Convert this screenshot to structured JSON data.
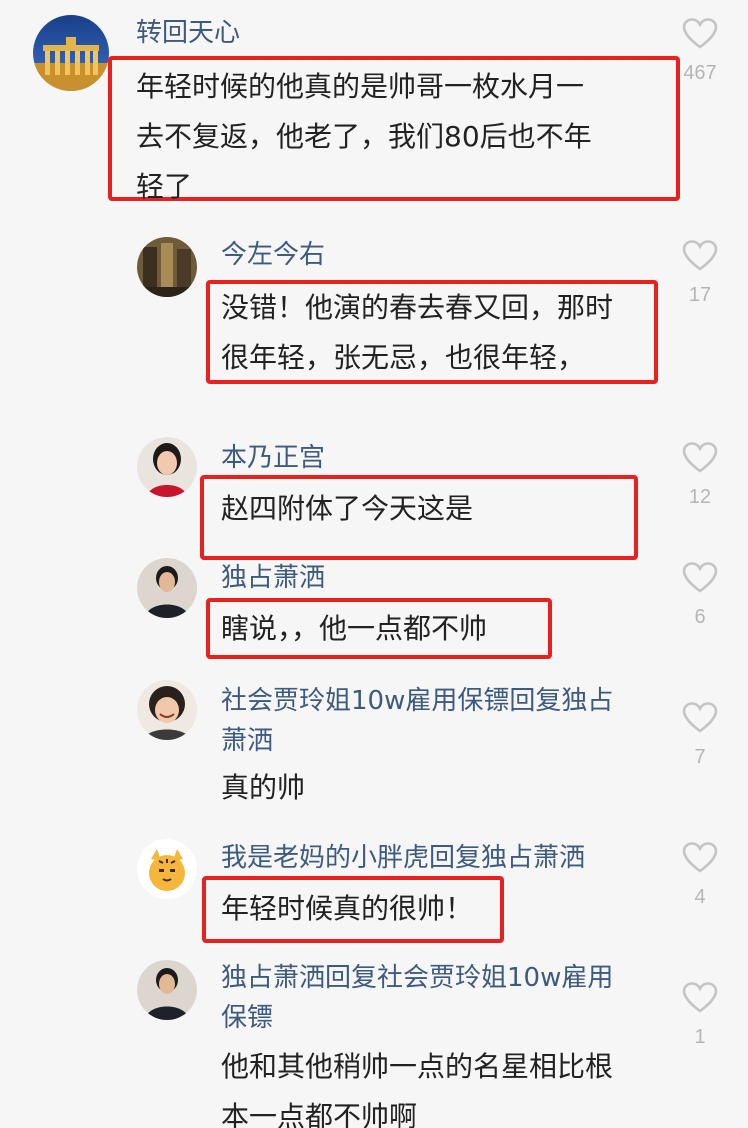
{
  "comments": [
    {
      "user": "转回天心",
      "text_lines": [
        "年轻时候的他真的是帅哥一枚水月一",
        "去不复返，他老了，我们80后也不年",
        "轻了"
      ],
      "likes": "467"
    },
    {
      "user": "今左今右",
      "text_lines": [
        "没错！他演的春去春又回，那时",
        "很年轻，张无忌，也很年轻，"
      ],
      "likes": "17"
    },
    {
      "user": "本乃正宫",
      "text_lines": [
        "赵四附体了今天这是"
      ],
      "likes": "12"
    },
    {
      "user": "独占萧洒",
      "text_lines": [
        "瞎说，，他一点都不帅"
      ],
      "likes": "6"
    },
    {
      "user_lines": [
        "社会贾玲姐10w雇用保镖回复独占",
        "萧洒"
      ],
      "text_lines": [
        "真的帅"
      ],
      "likes": "7"
    },
    {
      "user": "我是老妈的小胖虎回复独占萧洒",
      "text_lines": [
        "年轻时候真的很帅！"
      ],
      "likes": "4"
    },
    {
      "user_lines": [
        "独占萧洒回复社会贾玲姐10w雇用",
        "保镖"
      ],
      "text_lines": [
        "他和其他稍帅一点的名星相比根",
        "本一点都不帅啊"
      ],
      "likes": "1"
    }
  ],
  "colors": {
    "username": "#3d5a80",
    "highlight": "#e8201e",
    "like_icon": "#c4c4c4",
    "background": "#f6f6f6"
  },
  "icons": {
    "like": "heart-outline-icon"
  }
}
